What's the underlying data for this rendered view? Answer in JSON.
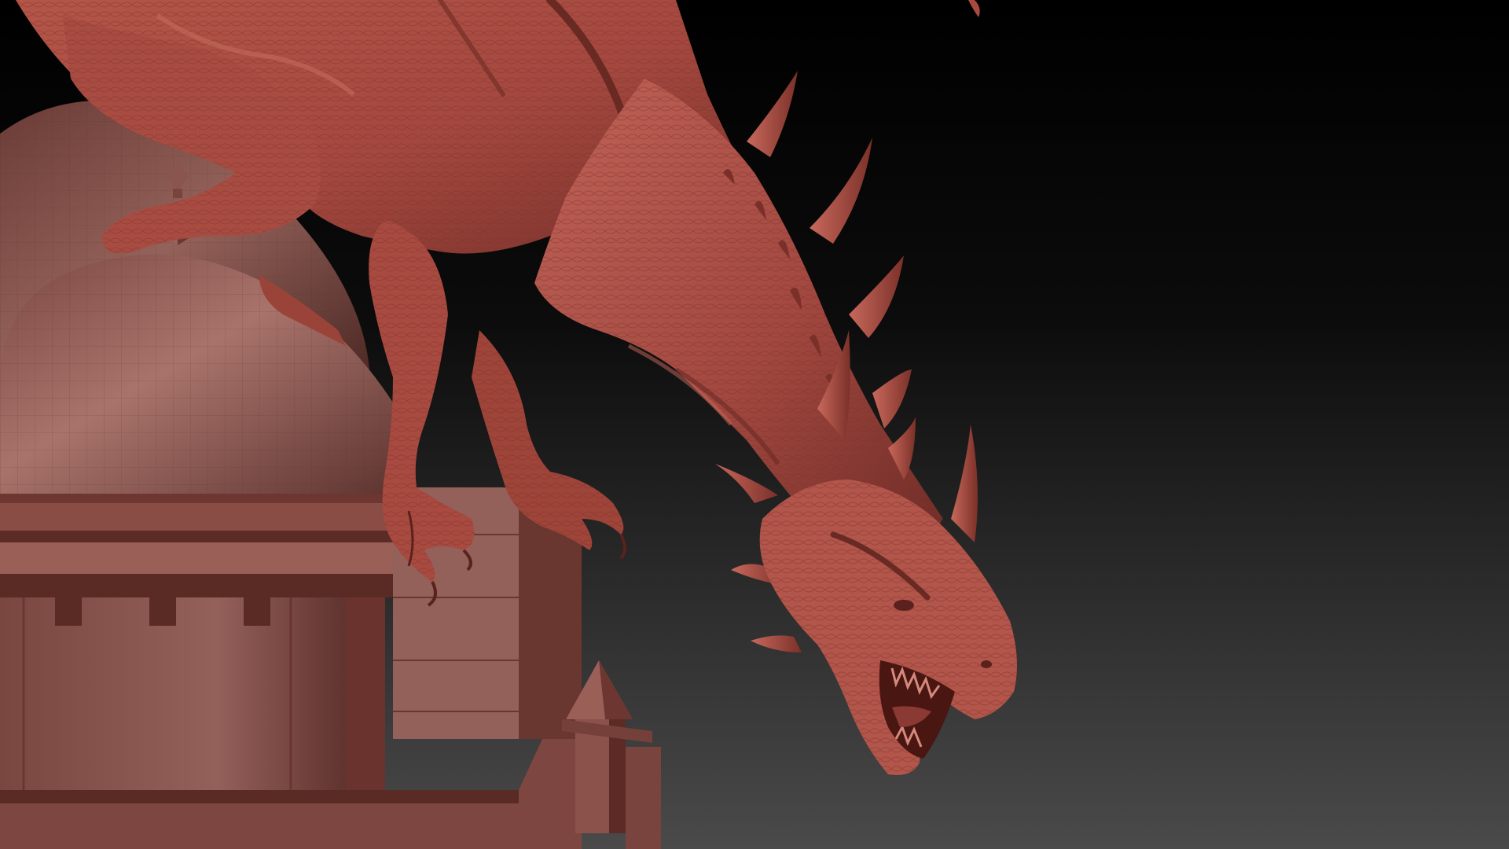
{
  "viewport": {
    "kind": "3d-sculpt-viewport",
    "subject": "dragon-on-domed-tower",
    "colors": {
      "background_top": "#000000",
      "background_bottom": "#4a4a4a",
      "clay_base": "#a4483f",
      "clay_light": "#c9685c",
      "clay_dark": "#5e2520",
      "building_base": "#8a4a44",
      "building_light": "#a86a62",
      "building_dark": "#4e2420"
    }
  }
}
